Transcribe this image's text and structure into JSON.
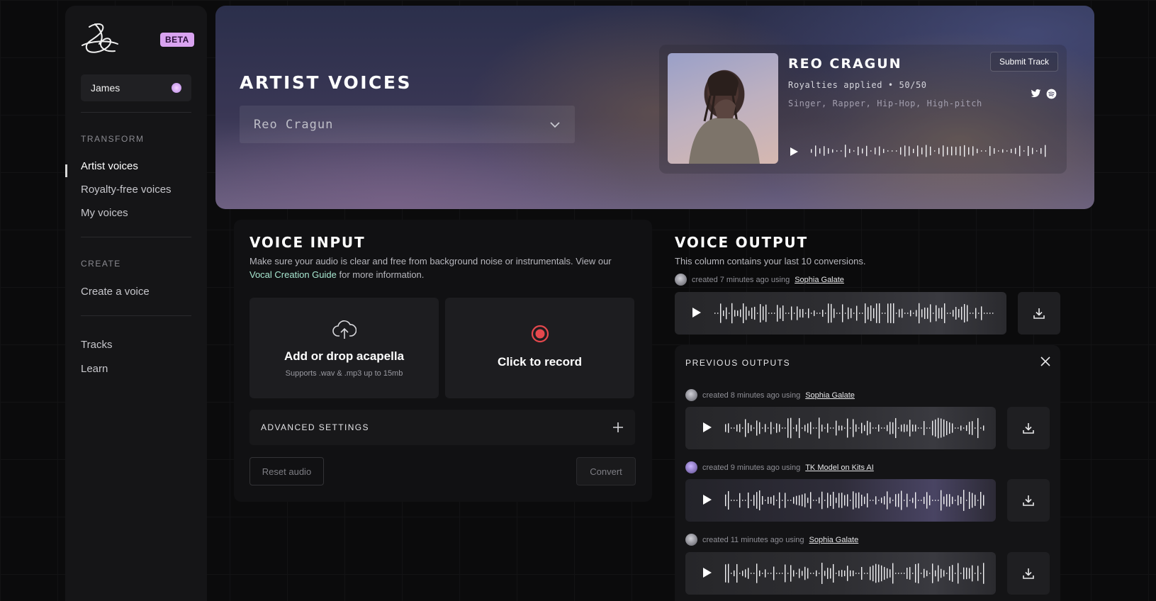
{
  "sidebar": {
    "beta": "BETA",
    "user": "James",
    "sections": {
      "transform": "TRANSFORM",
      "create": "CREATE"
    },
    "transform_items": [
      "Artist voices",
      "Royalty-free voices",
      "My voices"
    ],
    "create_items": [
      "Create a voice"
    ],
    "other_items": [
      "Tracks",
      "Learn"
    ]
  },
  "hero": {
    "title": "ARTIST VOICES",
    "selected_artist": "Reo Cragun",
    "artist": {
      "name": "REO CRAGUN",
      "royalties": "Royalties applied • 50/50",
      "tags": "Singer, Rapper, Hip-Hop, High-pitch",
      "submit": "Submit Track"
    }
  },
  "voice_input": {
    "title": "VOICE INPUT",
    "desc_pre": "Make sure your audio is clear and free from background noise or instrumentals. View our",
    "desc_link": "Vocal Creation Guide",
    "desc_post": " for more information.",
    "upload_title": "Add or drop acapella",
    "upload_sub": "Supports .wav & .mp3 up to 15mb",
    "record_title": "Click to record",
    "advanced": "ADVANCED SETTINGS",
    "reset": "Reset audio",
    "convert": "Convert"
  },
  "voice_output": {
    "title": "VOICE OUTPUT",
    "desc": "This column contains your last 10 conversions.",
    "latest": {
      "meta": "created 7 minutes ago using",
      "model": "Sophia Galate"
    },
    "previous_title": "PREVIOUS OUTPUTS",
    "previous": [
      {
        "meta": "created 8 minutes ago using",
        "model": "Sophia Galate"
      },
      {
        "meta": "created 9 minutes ago using",
        "model": "TK Model on Kits AI"
      },
      {
        "meta": "created 11 minutes ago using",
        "model": "Sophia Galate"
      }
    ]
  },
  "colors": {
    "accent_beta": "#d9a3f0",
    "record_red": "#e5484d",
    "link": "#a7e7d0"
  }
}
